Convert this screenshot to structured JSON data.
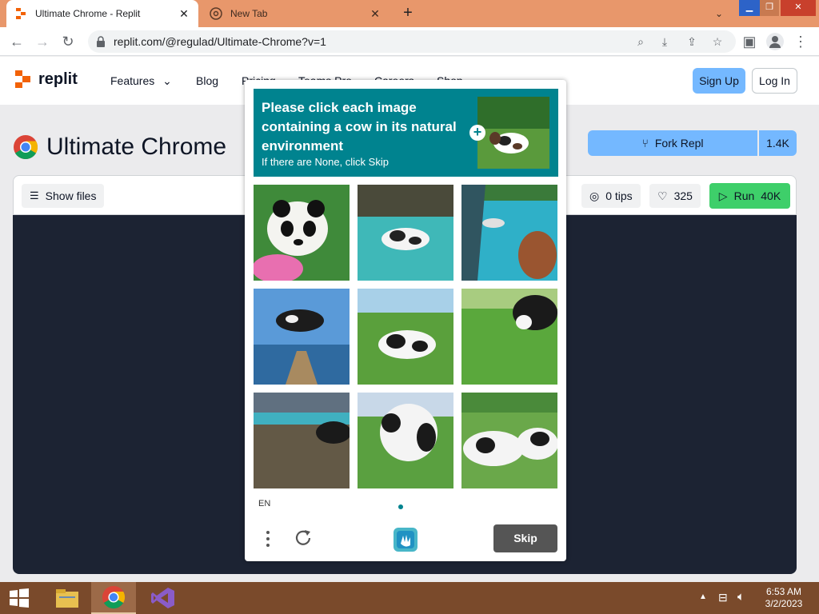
{
  "browser": {
    "tabs": [
      {
        "title": "Ultimate Chrome - Replit",
        "active": true
      },
      {
        "title": "New Tab",
        "active": false
      }
    ],
    "new_tab_label": "+",
    "url": "replit.com/@regulad/Ultimate-Chrome?v=1",
    "window_controls": [
      "minimize",
      "restore",
      "close"
    ]
  },
  "site": {
    "logo_text": "replit",
    "nav": [
      "Features",
      "Blog",
      "Pricing",
      "Teams Pro",
      "Careers",
      "Shop"
    ],
    "sign_up": "Sign Up",
    "log_in": "Log In"
  },
  "repl": {
    "title": "Ultimate Chrome",
    "fork_label": "Fork Repl",
    "fork_count": "1.4K",
    "show_files": "Show files",
    "tips": "0 tips",
    "likes": "325",
    "run_label": "Run",
    "run_count": "40K"
  },
  "captcha": {
    "prompt": "Please click each image containing a cow in its natural environment",
    "subprompt": "If there are None, click Skip",
    "language": "EN",
    "skip_label": "Skip",
    "images": [
      "panda with pink flowers",
      "cow floating over water",
      "cow by boat in water",
      "cow flying over pier",
      "cow grazing in field",
      "cow standing in field",
      "cow on dock by water",
      "cow close-up in pasture",
      "cows lying in grass"
    ]
  },
  "taskbar": {
    "apps": [
      "start",
      "file-explorer",
      "chrome",
      "visual-studio"
    ],
    "time": "6:53 AM",
    "date": "3/2/2023"
  },
  "colors": {
    "tabstrip": "#e8976b",
    "captcha_teal": "#00838f",
    "replit_blue": "#74b8ff",
    "run_green": "#3ecf6a",
    "console_bg": "#1c2333",
    "taskbar": "#7a4a2b"
  }
}
